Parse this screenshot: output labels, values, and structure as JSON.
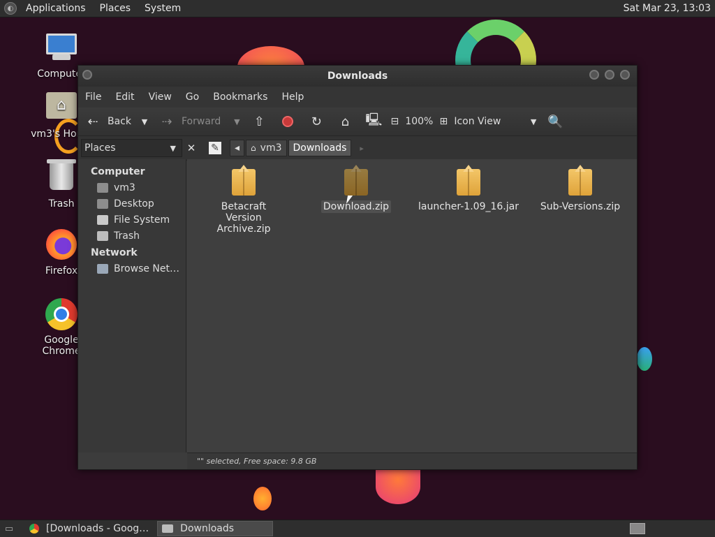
{
  "top_panel": {
    "menus": [
      "Applications",
      "Places",
      "System"
    ],
    "clock": "Sat Mar 23, 13:03"
  },
  "desktop": {
    "icons": [
      {
        "label": "Computer",
        "icon": "computer-icon"
      },
      {
        "label": "vm3's Home",
        "icon": "home-folder-icon"
      },
      {
        "label": "Trash",
        "icon": "trash-icon"
      },
      {
        "label": "Firefox",
        "icon": "firefox-icon"
      },
      {
        "label": "Google Chrome",
        "icon": "chrome-icon"
      }
    ]
  },
  "window": {
    "title": "Downloads",
    "menu": [
      "File",
      "Edit",
      "View",
      "Go",
      "Bookmarks",
      "Help"
    ],
    "toolbar": {
      "back": "Back",
      "forward": "Forward",
      "zoom": "100%",
      "view_mode": "Icon View"
    },
    "places_label": "Places",
    "breadcrumbs": [
      "vm3",
      "Downloads"
    ],
    "sidebar": {
      "sections": [
        {
          "heading": "Computer",
          "items": [
            "vm3",
            "Desktop",
            "File System",
            "Trash"
          ]
        },
        {
          "heading": "Network",
          "items": [
            "Browse Net…"
          ]
        }
      ]
    },
    "files": [
      {
        "name": "Betacraft Version Archive.zip",
        "selected": false
      },
      {
        "name": "Download.zip",
        "selected": true
      },
      {
        "name": "launcher-1.09_16.jar",
        "selected": false
      },
      {
        "name": "Sub-Versions.zip",
        "selected": false
      }
    ],
    "status": "\"\" selected, Free space: 9.8 GB"
  },
  "taskbar": {
    "tasks": [
      {
        "label": "[Downloads - Goog…",
        "active": false
      },
      {
        "label": "Downloads",
        "active": true
      }
    ]
  }
}
